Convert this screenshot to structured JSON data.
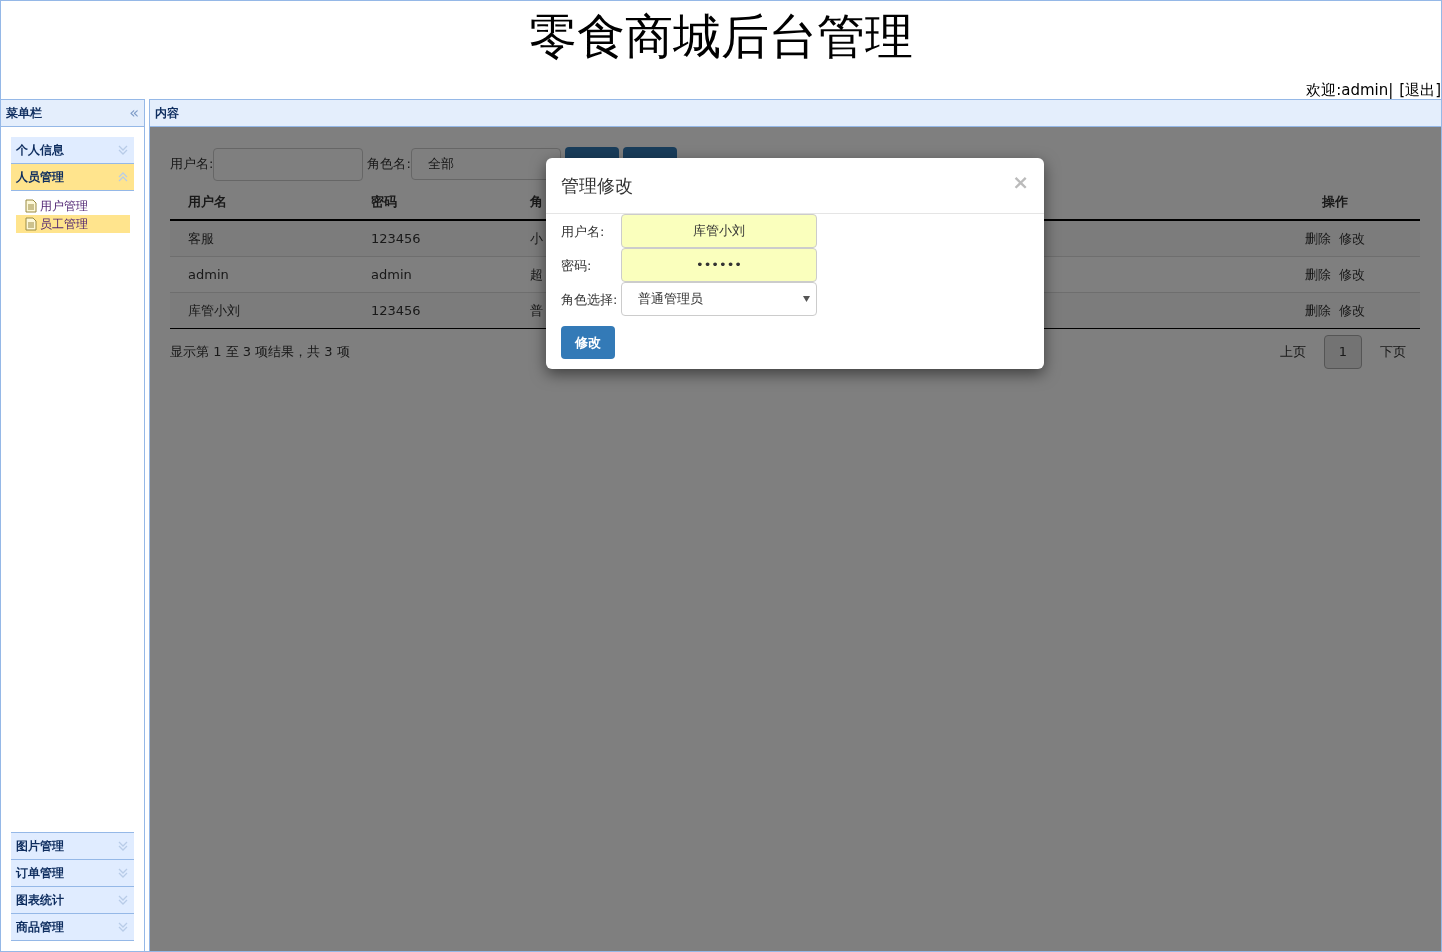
{
  "header": {
    "title": "零食商城后台管理",
    "welcome": "欢迎:admin|",
    "logout": "[退出]"
  },
  "sidebar": {
    "title": "菜单栏",
    "collapse": "«",
    "top_groups": [
      {
        "label": "个人信息",
        "expanded": false
      },
      {
        "label": "人员管理",
        "expanded": true,
        "children": [
          {
            "label": "用户管理",
            "selected": false
          },
          {
            "label": "员工管理",
            "selected": true
          }
        ]
      }
    ],
    "bottom_groups": [
      {
        "label": "图片管理",
        "expanded": false
      },
      {
        "label": "订单管理",
        "expanded": false
      },
      {
        "label": "图表统计",
        "expanded": false
      },
      {
        "label": "商品管理",
        "expanded": false
      }
    ]
  },
  "content": {
    "title": "内容",
    "filters": [
      {
        "label": "用户名:",
        "kind": "input"
      },
      {
        "label": "角色名:",
        "kind": "select",
        "value": "全部"
      }
    ],
    "table": {
      "columns": [
        "用户名",
        "密码",
        "角",
        "操作"
      ],
      "rows": [
        {
          "cells": [
            "客服",
            "123456",
            "小"
          ],
          "actions": [
            "删除",
            "修改"
          ]
        },
        {
          "cells": [
            "admin",
            "admin",
            "超"
          ],
          "actions": [
            "删除",
            "修改"
          ]
        },
        {
          "cells": [
            "库管小刘",
            "123456",
            "普"
          ],
          "actions": [
            "删除",
            "修改"
          ]
        }
      ]
    },
    "summary": "显示第 1 至 3 项结果，共 3 项",
    "pagination": {
      "prev": "上页",
      "page": "1",
      "next": "下页"
    }
  },
  "modal": {
    "title": "管理修改",
    "close": "×",
    "fields": [
      {
        "label": "用户名:",
        "kind": "text",
        "value": "库管小刘"
      },
      {
        "label": "密码:",
        "kind": "password",
        "value": "••••••"
      },
      {
        "label": "角色选择:",
        "kind": "select",
        "value": "普通管理员"
      }
    ],
    "submit": "修改"
  }
}
